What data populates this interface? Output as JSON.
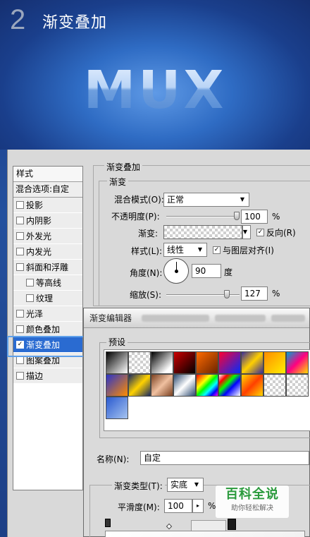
{
  "header": {
    "step_number": "2",
    "title": "渐变叠加",
    "logo_text": "MUX"
  },
  "styles_panel": {
    "heading": "样式",
    "blend_options": "混合选项:自定",
    "items": [
      {
        "label": "投影",
        "checked": false,
        "sub": false
      },
      {
        "label": "内阴影",
        "checked": false,
        "sub": false
      },
      {
        "label": "外发光",
        "checked": false,
        "sub": false
      },
      {
        "label": "内发光",
        "checked": false,
        "sub": false
      },
      {
        "label": "斜面和浮雕",
        "checked": false,
        "sub": false
      },
      {
        "label": "等高线",
        "checked": false,
        "sub": true
      },
      {
        "label": "纹理",
        "checked": false,
        "sub": true
      },
      {
        "label": "光泽",
        "checked": false,
        "sub": false
      },
      {
        "label": "颜色叠加",
        "checked": false,
        "sub": false
      },
      {
        "label": "渐变叠加",
        "checked": true,
        "sub": false,
        "active": true
      },
      {
        "label": "图案叠加",
        "checked": false,
        "sub": false
      },
      {
        "label": "描边",
        "checked": false,
        "sub": false
      }
    ],
    "check_mark": "✓"
  },
  "gradient_overlay": {
    "group_title": "渐变叠加",
    "sub_group_title": "渐变",
    "blend_mode_label": "混合模式(O):",
    "blend_mode_value": "正常",
    "opacity_label": "不透明度(P):",
    "opacity_value": "100",
    "opacity_unit": "%",
    "opacity_level": 1.0,
    "gradient_label": "渐变:",
    "reverse_label": "反向(R)",
    "reverse_checked": true,
    "style_label": "样式(L):",
    "style_value": "线性",
    "align_label": "与图层对齐(I)",
    "align_checked": true,
    "angle_label": "角度(N):",
    "angle_value": "90",
    "angle_unit": "度",
    "scale_label": "缩放(S):",
    "scale_value": "127",
    "scale_unit": "%",
    "scale_level": 0.85
  },
  "gradient_editor": {
    "title": "渐变编辑器",
    "presets_label": "预设",
    "name_label": "名称(N):",
    "name_value": "自定",
    "gradient_type_label": "渐变类型(T):",
    "gradient_type_value": "实底",
    "smoothness_label": "平滑度(M):",
    "smoothness_value": "100",
    "smoothness_unit": "%"
  },
  "watermark": {
    "main": "百科全说",
    "sub": "助你轻松解决"
  },
  "colors": {
    "selection": "#2a6bd1",
    "watermark_green": "#2a9a3c",
    "highlight_border": "#5fa0ea"
  }
}
